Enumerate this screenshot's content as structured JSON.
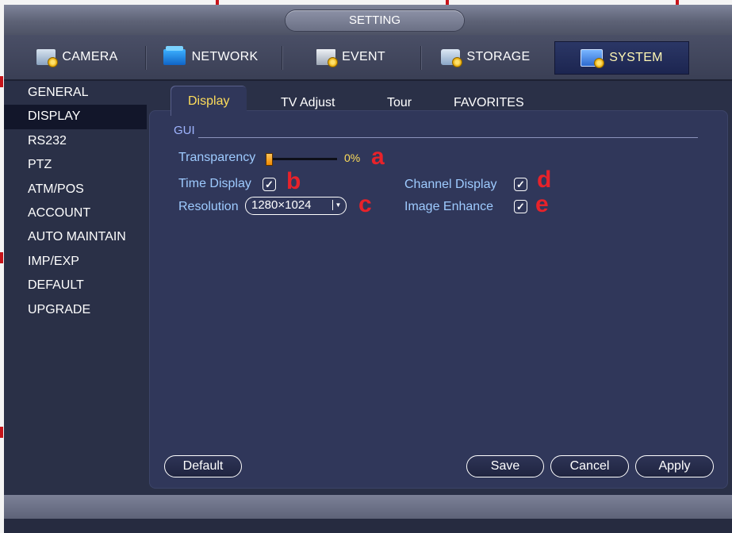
{
  "window": {
    "title": "SETTING"
  },
  "main_tabs": [
    {
      "label": "CAMERA",
      "icon": "camera-settings-icon"
    },
    {
      "label": "NETWORK",
      "icon": "network-icon"
    },
    {
      "label": "EVENT",
      "icon": "event-icon"
    },
    {
      "label": "STORAGE",
      "icon": "storage-icon"
    },
    {
      "label": "SYSTEM",
      "icon": "system-icon",
      "active": true
    }
  ],
  "sidebar": {
    "items": [
      {
        "label": "GENERAL"
      },
      {
        "label": "DISPLAY",
        "active": true
      },
      {
        "label": "RS232"
      },
      {
        "label": "PTZ"
      },
      {
        "label": "ATM/POS"
      },
      {
        "label": "ACCOUNT"
      },
      {
        "label": "AUTO MAINTAIN"
      },
      {
        "label": "IMP/EXP"
      },
      {
        "label": "DEFAULT"
      },
      {
        "label": "UPGRADE"
      }
    ]
  },
  "sub_tabs": [
    {
      "label": "Display",
      "active": true
    },
    {
      "label": "TV Adjust"
    },
    {
      "label": "Tour"
    },
    {
      "label": "FAVORITES"
    }
  ],
  "gui": {
    "section_label": "GUI",
    "transparency_label": "Transparency",
    "transparency_value": "0%",
    "time_display_label": "Time Display",
    "time_display_checked": true,
    "resolution_label": "Resolution",
    "resolution_value": "1280×1024",
    "channel_display_label": "Channel Display",
    "channel_display_checked": true,
    "image_enhance_label": "Image Enhance",
    "image_enhance_checked": true
  },
  "annotations": {
    "a": "a",
    "b": "b",
    "c": "c",
    "d": "d",
    "e": "e"
  },
  "buttons": {
    "default": "Default",
    "save": "Save",
    "cancel": "Cancel",
    "apply": "Apply"
  },
  "colors": {
    "active_text": "#ffde5a",
    "label_text": "#9ecbff",
    "annotation": "#e8222a",
    "panel": "#30375a"
  }
}
